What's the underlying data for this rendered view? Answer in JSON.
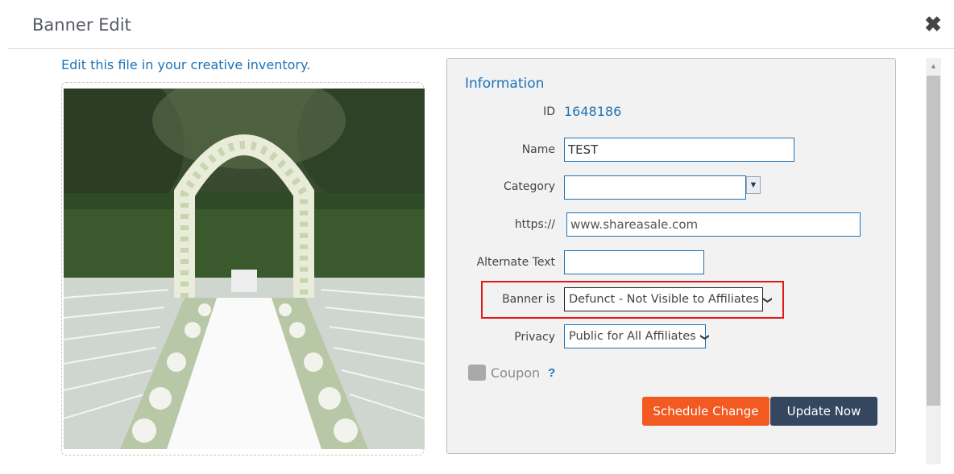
{
  "header": {
    "title": "Banner Edit",
    "close_icon": "close-icon"
  },
  "left": {
    "edit_link": "Edit this file in your creative inventory."
  },
  "panel": {
    "title": "Information",
    "id_label": "ID",
    "id_value": "1648186",
    "name_label": "Name",
    "name_value": "TEST",
    "category_label": "Category",
    "category_value": "",
    "url_label": "https://",
    "url_value": "www.shareasale.com",
    "alt_label": "Alternate Text",
    "alt_value": "",
    "banner_is_label": "Banner is",
    "banner_is_value": "Defunct - Not Visible to Affiliates",
    "privacy_label": "Privacy",
    "privacy_value": "Public for All Affiliates",
    "coupon_label": "Coupon",
    "coupon_help": "?",
    "schedule_button": "Schedule Change",
    "update_button": "Update Now"
  },
  "colors": {
    "link": "#1e73b8",
    "schedule": "#f25a22",
    "update": "#34475f",
    "highlight": "#e01a1a"
  }
}
